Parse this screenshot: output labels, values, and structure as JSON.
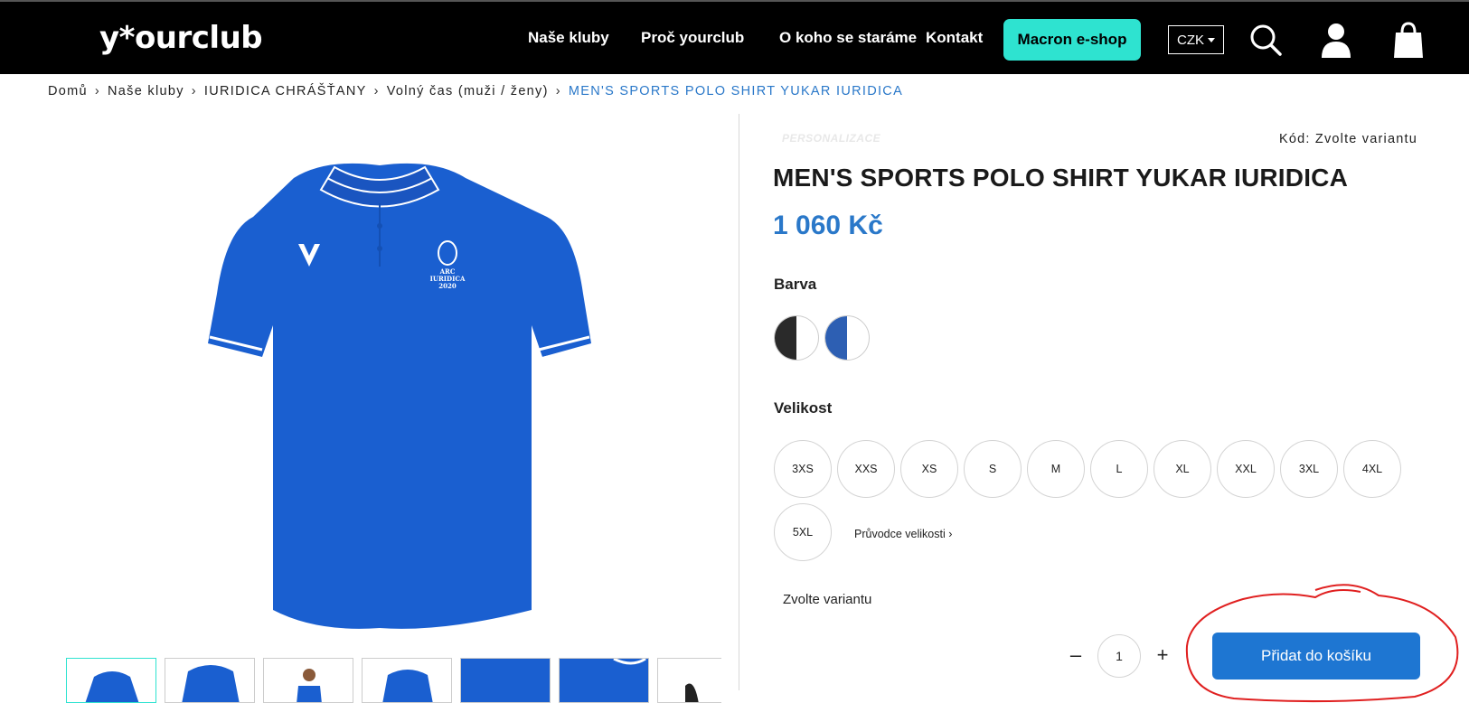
{
  "header": {
    "logo": "y*ourclub",
    "nav": [
      "Naše kluby",
      "Proč yourclub",
      "O koho se staráme",
      "Kontakt"
    ],
    "eshop_button": "Macron e-shop",
    "currency": "CZK",
    "icons": [
      "search-icon",
      "user-icon",
      "cart-icon"
    ]
  },
  "breadcrumb": {
    "items": [
      "Domů",
      "Naše kluby",
      "IURIDICA CHRÁŠŤANY",
      "Volný čas (muži / ženy)"
    ],
    "current": "MEN'S SPORTS POLO SHIRT YUKAR IURIDICA",
    "separator": "›"
  },
  "product": {
    "personalization_label": "PERSONALIZACE",
    "code": "Kód: Zvolte variantu",
    "title": "MEN'S SPORTS POLO SHIRT YUKAR IURIDICA",
    "price": "1 060 Kč",
    "image_logo_text": [
      "ARC",
      "IURIDICA",
      "2020"
    ],
    "color_label": "Barva",
    "colors": [
      {
        "name": "black",
        "hex": "#2a2a2a"
      },
      {
        "name": "blue",
        "hex": "#2d5fb3"
      }
    ],
    "size_label": "Velikost",
    "sizes": [
      "3XS",
      "XXS",
      "XS",
      "S",
      "M",
      "L",
      "XL",
      "XXL",
      "3XL",
      "4XL",
      "5XL"
    ],
    "size_guide": "Průvodce velikosti ›",
    "variant_message": "Zvolte variantu",
    "quantity": "1",
    "qty_minus": "–",
    "qty_plus": "+",
    "add_to_cart": "Přidat do košíku"
  },
  "colors": {
    "header_bg": "#000000",
    "accent_teal": "#2ee3d0",
    "price_blue": "#2a78c9",
    "button_blue": "#1e76d2",
    "shirt_blue": "#1a5fd0",
    "annotation_red": "#e02020"
  }
}
